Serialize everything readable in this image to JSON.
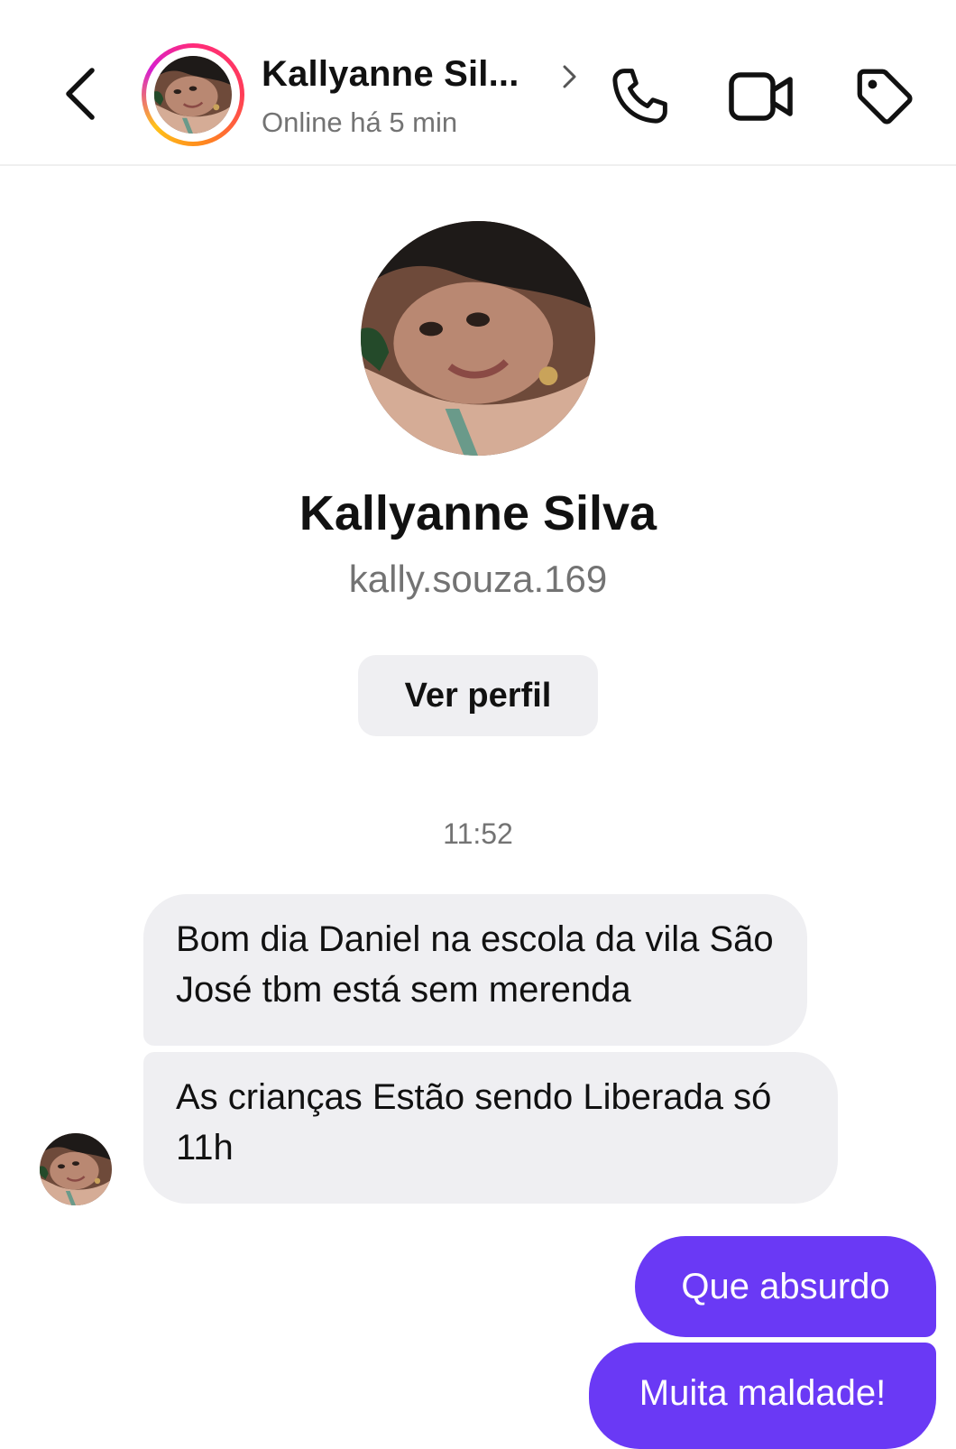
{
  "header": {
    "contact_name": "Kallyanne Sil...",
    "status": "Online há 5 min",
    "icons": {
      "back": "chevron-left-icon",
      "info": "chevron-right-icon",
      "call": "phone-icon",
      "video": "video-camera-icon",
      "tag": "tag-icon"
    },
    "ring_colors": [
      "#ff2b7a",
      "#ff8a1d",
      "#ffc21a",
      "#d61fcf"
    ]
  },
  "profile": {
    "name": "Kallyanne Silva",
    "username": "kally.souza.169",
    "view_profile_label": "Ver perfil"
  },
  "conversation": {
    "timestamp": "11:52",
    "messages": [
      {
        "from": "contact",
        "text": "Bom dia Daniel na escola da vila São José tbm está sem merenda"
      },
      {
        "from": "contact",
        "text": "As crianças Estão sendo Liberada só 11h"
      },
      {
        "from": "me",
        "text": "Que absurdo"
      },
      {
        "from": "me",
        "text": "Muita maldade!"
      }
    ]
  },
  "colors": {
    "outgoing_bubble": "#6a39f5",
    "incoming_bubble": "#efeff2",
    "secondary_text": "#737373"
  }
}
